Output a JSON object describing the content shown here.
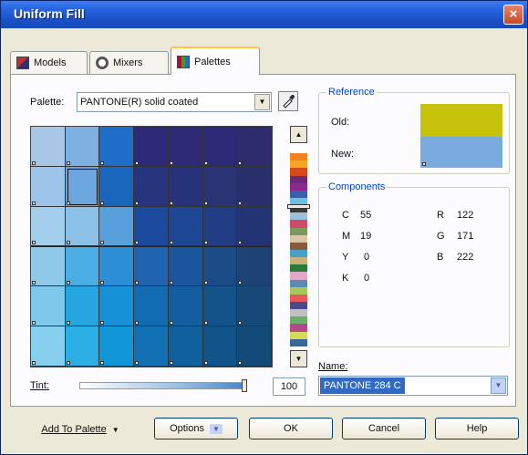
{
  "window": {
    "title": "Uniform Fill",
    "close_glyph": "×"
  },
  "tabs": [
    {
      "label": "Models",
      "icon": "models-icon"
    },
    {
      "label": "Mixers",
      "icon": "mixers-icon"
    },
    {
      "label": "Palettes",
      "icon": "palettes-icon",
      "active": true
    }
  ],
  "palette": {
    "label": "Palette:",
    "value": "PANTONE(R) solid coated"
  },
  "grid": {
    "rows": [
      [
        "#a8c6e6",
        "#7eb1e2",
        "#1e6ec7",
        "#2c2a78",
        "#2e2a76",
        "#2c2a74",
        "#2e2b6e"
      ],
      [
        "#9cc3e8",
        "#6ca6de",
        "#1a66bc",
        "#27347e",
        "#283278",
        "#2a3474",
        "#2a306c"
      ],
      [
        "#a4cfec",
        "#8bc0e8",
        "#58a0dc",
        "#1b4a9e",
        "#1d4694",
        "#203c82",
        "#223474"
      ],
      [
        "#8ec9ea",
        "#4aaee4",
        "#2b8ed6",
        "#1e62b0",
        "#1b569c",
        "#1c4c88",
        "#1e4274"
      ],
      [
        "#7ec8ec",
        "#25a6e0",
        "#1690d6",
        "#126cb4",
        "#125ea0",
        "#14528a",
        "#164878"
      ],
      [
        "#86cfee",
        "#2aaee4",
        "#1196d8",
        "#1270b4",
        "#10609e",
        "#10548a",
        "#124a78"
      ]
    ]
  },
  "strip_colors": [
    "#ffffff",
    "#f58220",
    "#f5a623",
    "#d44a1c",
    "#6e2b7a",
    "#8a2a8f",
    "#3a5fa8",
    "#6cc0e0",
    "#3a3a3a",
    "#9cc0d8",
    "#d04a6a",
    "#7a9a5c",
    "#d9c7a8",
    "#8a5a3a",
    "#4aa0c8",
    "#c8b07a",
    "#2a7a3a",
    "#e0a8c8",
    "#5a8ab0",
    "#a8c85a",
    "#e85a5a",
    "#4a4a8a",
    "#c0c0c0",
    "#6ab06a",
    "#b04a8a",
    "#d8d85a",
    "#3a6a9a"
  ],
  "reference": {
    "title": "Reference",
    "old_label": "Old:",
    "new_label": "New:",
    "old_color": "#c7c30a",
    "new_color": "#7aabde"
  },
  "components": {
    "title": "Components",
    "cmyk": [
      {
        "key": "C",
        "value": "55"
      },
      {
        "key": "M",
        "value": "19"
      },
      {
        "key": "Y",
        "value": "0"
      },
      {
        "key": "K",
        "value": "0"
      }
    ],
    "rgb": [
      {
        "key": "R",
        "value": "122"
      },
      {
        "key": "G",
        "value": "171"
      },
      {
        "key": "B",
        "value": "222"
      }
    ]
  },
  "name": {
    "label": "Name:",
    "value": "PANTONE 284 C"
  },
  "tint": {
    "label": "Tint:",
    "value": "100",
    "level": 1.0
  },
  "buttons": {
    "add_to_palette": "Add To Palette",
    "options": "Options",
    "ok": "OK",
    "cancel": "Cancel",
    "help": "Help"
  },
  "colors": {
    "accent": "#0046d5",
    "selection": "#316ac5"
  }
}
